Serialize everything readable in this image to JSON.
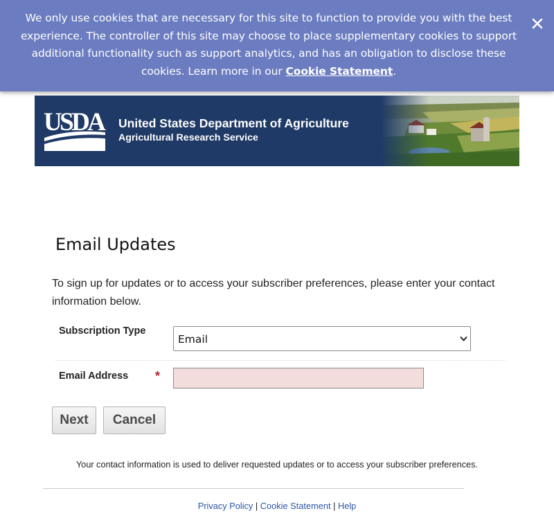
{
  "cookie_banner": {
    "text": "We only use cookies that are necessary for this site to function to provide you with the best experience. The controller of this site may choose to place supplementary cookies to support additional functionality such as support analytics, and has an obligation to disclose these cookies. Learn more in our",
    "link_label": "Cookie Statement",
    "trailing": ".",
    "close_icon": "close-icon",
    "background_color": "#6b7cc0"
  },
  "header": {
    "logo_text": "USDA",
    "title": "United States Department of Agriculture",
    "subtitle": "Agricultural Research Service",
    "background_color": "#1f3a66"
  },
  "main": {
    "page_title": "Email Updates",
    "intro": "To sign up for updates or to access your subscriber preferences, please enter your contact information below.",
    "form": {
      "subscription_type_label": "Subscription Type",
      "subscription_type_value": "Email",
      "email_label": "Email Address",
      "required_marker": "*",
      "email_value": "",
      "email_placeholder": ""
    },
    "buttons": {
      "next": "Next",
      "cancel": "Cancel"
    },
    "contact_note": "Your contact information is used to deliver requested updates or to access your subscriber preferences."
  },
  "footer": {
    "links": [
      "Privacy Policy",
      "Cookie Statement",
      "Help"
    ],
    "separator": "|",
    "link_color": "#2e56a6"
  }
}
